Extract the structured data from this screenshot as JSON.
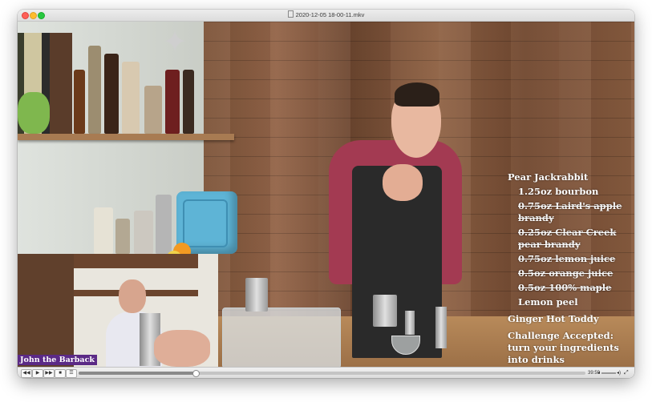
{
  "window": {
    "title": "2020-12-05 18-00-11.mkv"
  },
  "recipe": {
    "title": "Pear Jackrabbit",
    "ingredients": [
      {
        "text": "1.25oz bourbon",
        "struck": false
      },
      {
        "text": "0.75oz Laird's apple brandy",
        "struck": true
      },
      {
        "text": "0.25oz Clear Creek pear brandy",
        "struck": true
      },
      {
        "text": "0.75oz lemon juice",
        "struck": true
      },
      {
        "text": "0.5oz orange juice",
        "struck": true
      },
      {
        "text": "0.5oz 100% maple",
        "struck": true
      },
      {
        "text": "Lemon peel",
        "struck": false
      }
    ],
    "next_drink": "Ginger Hot Toddy",
    "challenge": "Challenge Accepted: turn your ingredients into drinks"
  },
  "pip": {
    "label": "John the Barback",
    "label_color": "#5b2a86"
  },
  "controls": {
    "rewind_icon": "rewind-icon",
    "play_icon": "play-icon",
    "forward_icon": "fast-forward-icon",
    "stop_icon": "stop-icon",
    "menu_icon": "list-icon",
    "progress_fraction": 0.23,
    "time": "39:59",
    "volume_fraction": 0.6
  }
}
